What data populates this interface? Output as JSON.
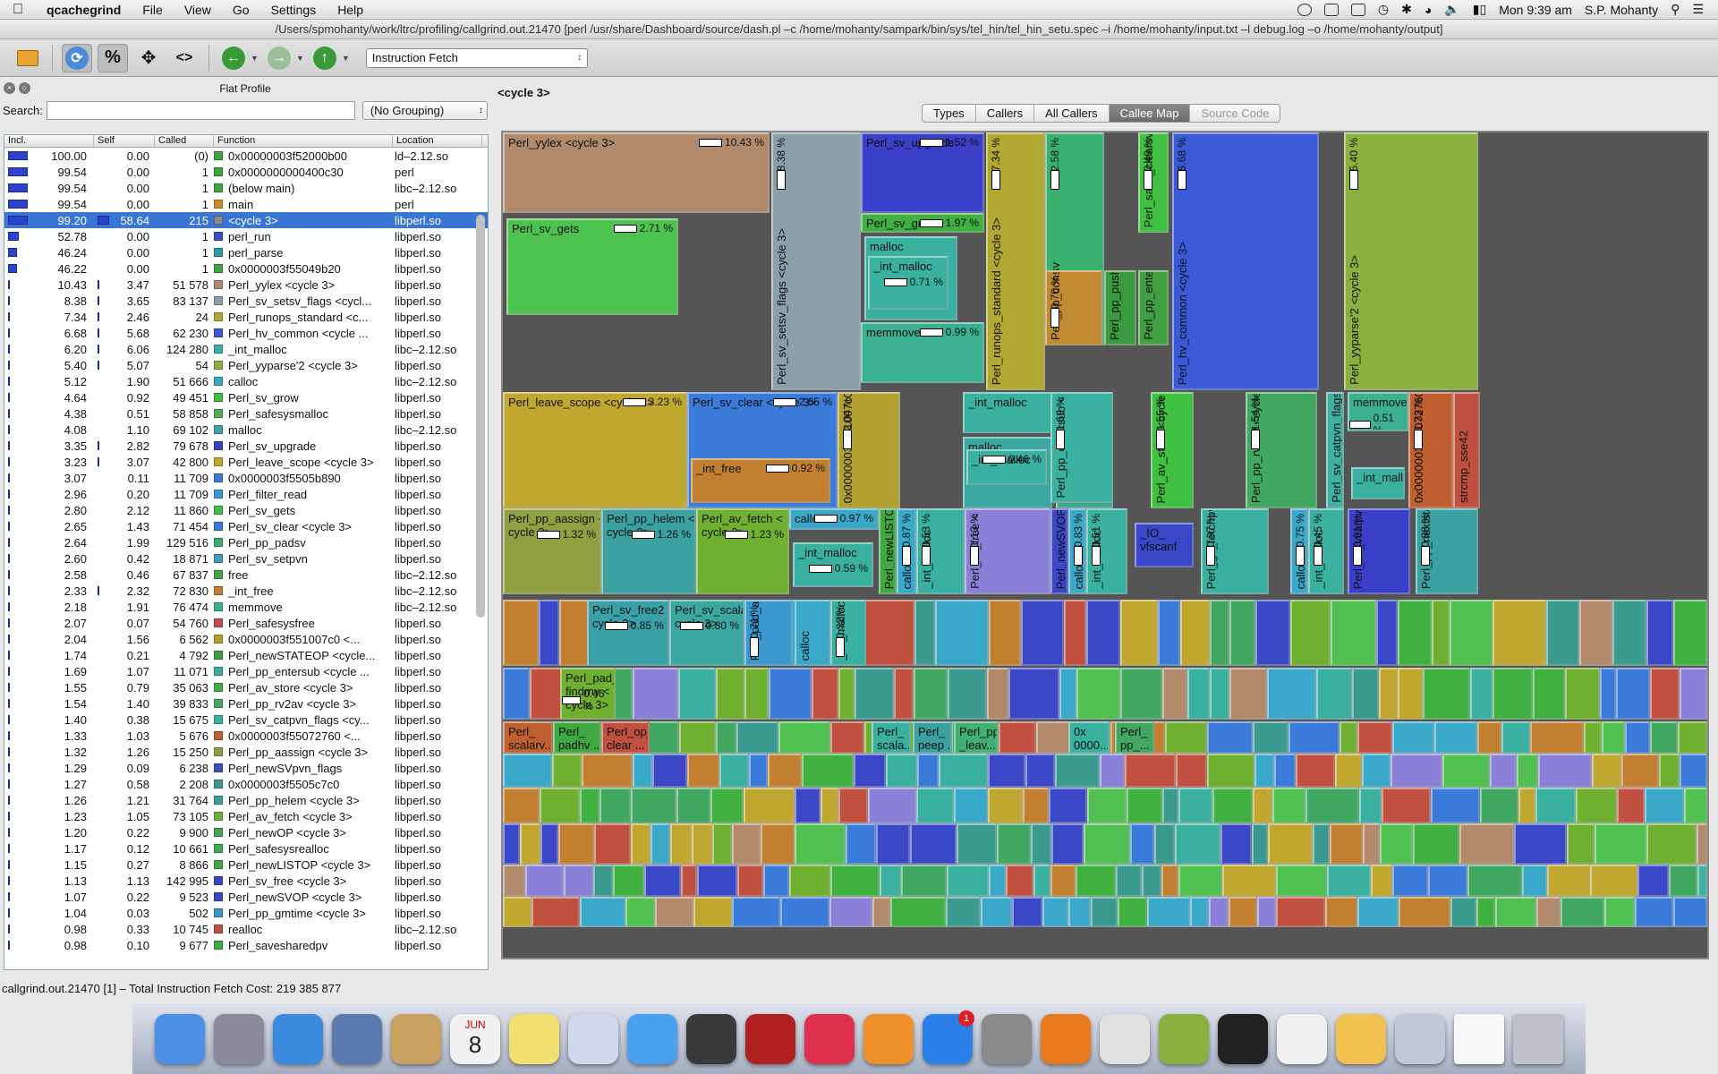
{
  "menubar": {
    "app": "qcachegrind",
    "items": [
      "File",
      "View",
      "Go",
      "Settings",
      "Help"
    ],
    "clock": "Mon 9:39 am",
    "user": "S.P. Mohanty"
  },
  "window": {
    "title": "/Users/spmohanty/work/ltrc/profiling/callgrind.out.21470 [perl /usr/share/Dashboard/source/dash.pl –c /home/mohanty/sampark/bin/sys/tel_hin/tel_hin_setu.spec –i /home/mohanty/input.txt –l debug.log –o /home/mohanty/output]"
  },
  "toolbar": {
    "percent_label": "%",
    "code_label": "<>",
    "event_type": "Instruction Fetch"
  },
  "flat_profile": {
    "title": "Flat Profile",
    "search_label": "Search:",
    "search_value": "",
    "grouping": "(No Grouping)",
    "columns": [
      "Incl.",
      "Self",
      "Called",
      "Function",
      "Location"
    ],
    "rows": [
      {
        "incl": "100.00",
        "self": "0.00",
        "called": "(0)",
        "fn": "0x00000003f52000b00",
        "loc": "ld–2.12.so",
        "color": "#3aa83a"
      },
      {
        "incl": "99.54",
        "self": "0.00",
        "called": "1",
        "fn": "0x0000000000400c30",
        "loc": "perl",
        "color": "#3aa83a"
      },
      {
        "incl": "99.54",
        "self": "0.00",
        "called": "1",
        "fn": "(below main)",
        "loc": "libc–2.12.so",
        "color": "#3aa83a"
      },
      {
        "incl": "99.54",
        "self": "0.00",
        "called": "1",
        "fn": "main",
        "loc": "perl",
        "color": "#c98a2a"
      },
      {
        "incl": "99.20",
        "self": "58.64",
        "called": "215",
        "fn": "<cycle 3>",
        "loc": "libperl.so",
        "color": "#8a8a8a",
        "selected": true
      },
      {
        "incl": "52.78",
        "self": "0.00",
        "called": "1",
        "fn": "perl_run",
        "loc": "libperl.so",
        "color": "#3a4fc8"
      },
      {
        "incl": "46.24",
        "self": "0.00",
        "called": "1",
        "fn": "perl_parse",
        "loc": "libperl.so",
        "color": "#2a9aa8"
      },
      {
        "incl": "46.22",
        "self": "0.00",
        "called": "1",
        "fn": "0x0000003f55049b20",
        "loc": "libperl.so",
        "color": "#3aa83a"
      },
      {
        "incl": "10.43",
        "self": "3.47",
        "called": "51 578",
        "fn": "Perl_yylex <cycle 3>",
        "loc": "libperl.so",
        "color": "#b08a6a"
      },
      {
        "incl": "8.38",
        "self": "3.65",
        "called": "83 137",
        "fn": "Perl_sv_setsv_flags <cycl...",
        "loc": "libperl.so",
        "color": "#8aa0a8"
      },
      {
        "incl": "7.34",
        "self": "2.46",
        "called": "24",
        "fn": "Perl_runops_standard <c...",
        "loc": "libperl.so",
        "color": "#b0a830"
      },
      {
        "incl": "6.68",
        "self": "5.68",
        "called": "62 230",
        "fn": "Perl_hv_common <cycle ...",
        "loc": "libperl.so",
        "color": "#3a5ad8"
      },
      {
        "incl": "6.20",
        "self": "6.06",
        "called": "124 280",
        "fn": "_int_malloc",
        "loc": "libc–2.12.so",
        "color": "#3ab0a8"
      },
      {
        "incl": "5.40",
        "self": "5.07",
        "called": "54",
        "fn": "Perl_yyparse'2 <cycle 3>",
        "loc": "libperl.so",
        "color": "#8ab040"
      },
      {
        "incl": "5.12",
        "self": "1.90",
        "called": "51 666",
        "fn": "calloc",
        "loc": "libc–2.12.so",
        "color": "#3aa8c8"
      },
      {
        "incl": "4.64",
        "self": "0.92",
        "called": "49 451",
        "fn": "Perl_sv_grow",
        "loc": "libperl.so",
        "color": "#40c040"
      },
      {
        "incl": "4.38",
        "self": "0.51",
        "called": "58 858",
        "fn": "Perl_safesysmalloc",
        "loc": "libperl.so",
        "color": "#50b050"
      },
      {
        "incl": "4.08",
        "self": "1.10",
        "called": "69 102",
        "fn": "malloc",
        "loc": "libc–2.12.so",
        "color": "#3aa8a0"
      },
      {
        "incl": "3.35",
        "self": "2.82",
        "called": "79 678",
        "fn": "Perl_sv_upgrade",
        "loc": "libperl.so",
        "color": "#3a40c8"
      },
      {
        "incl": "3.23",
        "self": "3.07",
        "called": "42 800",
        "fn": "Perl_leave_scope <cycle 3>",
        "loc": "libperl.so",
        "color": "#c0a830"
      },
      {
        "incl": "3.07",
        "self": "0.11",
        "called": "11 709",
        "fn": "0x0000003f5505b890",
        "loc": "libperl.so",
        "color": "#3a7ad8"
      },
      {
        "incl": "2.96",
        "self": "0.20",
        "called": "11 709",
        "fn": "Perl_filter_read",
        "loc": "libperl.so",
        "color": "#3a9ad8"
      },
      {
        "incl": "2.80",
        "self": "2.12",
        "called": "11 860",
        "fn": "Perl_sv_gets",
        "loc": "libperl.so",
        "color": "#40c040"
      },
      {
        "incl": "2.65",
        "self": "1.43",
        "called": "71 454",
        "fn": "Perl_sv_clear <cycle 3>",
        "loc": "libperl.so",
        "color": "#3a7ad8"
      },
      {
        "incl": "2.64",
        "self": "1.99",
        "called": "129 516",
        "fn": "Perl_pp_padsv",
        "loc": "libperl.so",
        "color": "#3ab070"
      },
      {
        "incl": "2.60",
        "self": "0.42",
        "called": "18 871",
        "fn": "Perl_sv_setpvn",
        "loc": "libperl.so",
        "color": "#3aa0c0"
      },
      {
        "incl": "2.58",
        "self": "0.46",
        "called": "67 837",
        "fn": "free",
        "loc": "libc–2.12.so",
        "color": "#40a840"
      },
      {
        "incl": "2.33",
        "self": "2.32",
        "called": "72 830",
        "fn": "_int_free",
        "loc": "libc–2.12.so",
        "color": "#c08030"
      },
      {
        "incl": "2.18",
        "self": "1.91",
        "called": "76 474",
        "fn": "memmove",
        "loc": "libc–2.12.so",
        "color": "#3ab090"
      },
      {
        "incl": "2.07",
        "self": "0.07",
        "called": "54 760",
        "fn": "Perl_safesysfree",
        "loc": "libperl.so",
        "color": "#c05050"
      },
      {
        "incl": "2.04",
        "self": "1.56",
        "called": "6 562",
        "fn": "0x0000003f551007c0 <...",
        "loc": "libperl.so",
        "color": "#b0a030"
      },
      {
        "incl": "1.74",
        "self": "0.21",
        "called": "4 792",
        "fn": "Perl_newSTATEOP <cycle...",
        "loc": "libperl.so",
        "color": "#3aa040"
      },
      {
        "incl": "1.69",
        "self": "1.07",
        "called": "11 071",
        "fn": "Perl_pp_entersub <cycle ...",
        "loc": "libperl.so",
        "color": "#3ab0a0"
      },
      {
        "incl": "1.55",
        "self": "0.79",
        "called": "35 063",
        "fn": "Perl_av_store <cycle 3>",
        "loc": "libperl.so",
        "color": "#40b040"
      },
      {
        "incl": "1.54",
        "self": "1.40",
        "called": "39 833",
        "fn": "Perl_pp_rv2av <cycle 3>",
        "loc": "libperl.so",
        "color": "#40a860"
      },
      {
        "incl": "1.40",
        "self": "0.38",
        "called": "15 675",
        "fn": "Perl_sv_catpvn_flags <cy...",
        "loc": "libperl.so",
        "color": "#40b0a0"
      },
      {
        "incl": "1.33",
        "self": "1.03",
        "called": "5 676",
        "fn": "0x0000003f55072760 <...",
        "loc": "libperl.so",
        "color": "#c06030"
      },
      {
        "incl": "1.32",
        "self": "1.26",
        "called": "15 250",
        "fn": "Perl_pp_aassign <cycle 3>",
        "loc": "libperl.so",
        "color": "#90a040"
      },
      {
        "incl": "1.29",
        "self": "0.09",
        "called": "6 238",
        "fn": "Perl_newSVpvn_flags",
        "loc": "libperl.so",
        "color": "#3a50c0"
      },
      {
        "incl": "1.27",
        "self": "0.58",
        "called": "2 208",
        "fn": "0x0000003f5505c7c0",
        "loc": "libperl.so",
        "color": "#3a9a90"
      },
      {
        "incl": "1.26",
        "self": "1.21",
        "called": "31 764",
        "fn": "Perl_pp_helem <cycle 3>",
        "loc": "libperl.so",
        "color": "#3aa0a0"
      },
      {
        "incl": "1.23",
        "self": "1.05",
        "called": "73 105",
        "fn": "Perl_av_fetch <cycle 3>",
        "loc": "libperl.so",
        "color": "#70b030"
      },
      {
        "incl": "1.20",
        "self": "0.22",
        "called": "9 900",
        "fn": "Perl_newOP <cycle 3>",
        "loc": "libperl.so",
        "color": "#40a850"
      },
      {
        "incl": "1.17",
        "self": "0.12",
        "called": "10 661",
        "fn": "Perl_safesysrealloc",
        "loc": "libperl.so",
        "color": "#3ab050"
      },
      {
        "incl": "1.15",
        "self": "0.27",
        "called": "8 866",
        "fn": "Perl_newLISTOP <cycle 3>",
        "loc": "libperl.so",
        "color": "#40a840"
      },
      {
        "incl": "1.13",
        "self": "1.13",
        "called": "142 995",
        "fn": "Perl_sv_free <cycle 3>",
        "loc": "libperl.so",
        "color": "#3a48c0"
      },
      {
        "incl": "1.07",
        "self": "0.22",
        "called": "9 523",
        "fn": "Perl_newSVOP <cycle 3>",
        "loc": "libperl.so",
        "color": "#3a48c8"
      },
      {
        "incl": "1.04",
        "self": "0.03",
        "called": "502",
        "fn": "Perl_pp_gmtime <cycle 3>",
        "loc": "libperl.so",
        "color": "#3a9ad0"
      },
      {
        "incl": "0.98",
        "self": "0.33",
        "called": "10 745",
        "fn": "realloc",
        "loc": "libc–2.12.so",
        "color": "#c05040"
      },
      {
        "incl": "0.98",
        "self": "0.10",
        "called": "9 677",
        "fn": "Perl_savesharedpv",
        "loc": "libperl.so",
        "color": "#3ab040"
      }
    ]
  },
  "detail": {
    "header": "<cycle 3>",
    "tabs": [
      "Types",
      "Callers",
      "All Callers",
      "Callee Map",
      "Source Code"
    ],
    "active_tab": "Callee Map"
  },
  "callee_map": [
    {
      "label": "Perl_yylex <cycle 3>",
      "pct": "10.43 %"
    },
    {
      "label": "Perl_sv_gets",
      "pct": "2.71 %"
    },
    {
      "label": "Perl_sv_upgrade",
      "pct": "1.52 %"
    },
    {
      "label": "Perl_sv_grow",
      "pct": "1.97 %"
    },
    {
      "label": "malloc",
      "pct": ""
    },
    {
      "label": "_int_malloc",
      "pct": "0.71 %"
    },
    {
      "label": "memmove",
      "pct": "0.99 %"
    },
    {
      "label": "Perl_sv_setsv_flags <cycle 3>",
      "pct": "8.38 %"
    },
    {
      "label": "Perl_runops_standard <cycle 3>",
      "pct": "7.34 %"
    },
    {
      "label": "Perl_pp_padsv",
      "pct": "2.58 %"
    },
    {
      "label": "Perl_save_clearsv",
      "pct": "0.49 %"
    },
    {
      "label": "Perl_hv_common <cycle 3>",
      "pct": "6.68 %"
    },
    {
      "label": "Perl_yyparse'2 <cycle 3>",
      "pct": "5.40 %"
    },
    {
      "label": "Perl_pp_const",
      "pct": "0.70 %"
    },
    {
      "label": "Perl_pp_pushmark",
      "pct": ""
    },
    {
      "label": "Perl_pp_enter",
      "pct": ""
    },
    {
      "label": "Perl_leave_scope <cycle 3>",
      "pct": "3.23 %"
    },
    {
      "label": "Perl_sv_clear <cycle 3>",
      "pct": "2.65 %"
    },
    {
      "label": "_int_free",
      "pct": "0.92 %"
    },
    {
      "label": "0x0000003f551007c0 <cycle 3>",
      "pct": "2.04 %"
    },
    {
      "label": "_int_malloc",
      "pct": ""
    },
    {
      "label": "malloc",
      "pct": ""
    },
    {
      "label": "_int_malloc",
      "pct": "0.46 %"
    },
    {
      "label": "memcpy",
      "pct": ""
    },
    {
      "label": "Perl_pp_entersub < cycle 3>",
      "pct": "1.69 %"
    },
    {
      "label": "Perl_av_store <cycle 3>",
      "pct": "1.55 %"
    },
    {
      "label": "Perl_pp_rv2av <cycle 3>",
      "pct": "1.54 %"
    },
    {
      "label": "Perl_sv_catpvn_flags",
      "pct": ""
    },
    {
      "label": "memmove",
      "pct": "0.51 %"
    },
    {
      "label": "_int_malloc",
      "pct": ""
    },
    {
      "label": "0x0000003f55072760 <cycle 3>",
      "pct": "1.33 %"
    },
    {
      "label": "strcmp_sse42",
      "pct": ""
    },
    {
      "label": "Perl_pp_aassign <\ncycle 3>",
      "pct": "1.32 %"
    },
    {
      "label": "Perl_pp_helem <\ncycle 3>",
      "pct": "1.26 %"
    },
    {
      "label": "Perl_av_fetch <\ncycle 3>",
      "pct": "1.23 %"
    },
    {
      "label": "calloc",
      "pct": "0.97 %"
    },
    {
      "label": "_int_malloc",
      "pct": "0.59 %"
    },
    {
      "label": "Perl_newLISTOP",
      "pct": ""
    },
    {
      "label": "calloc",
      "pct": "0.87 %"
    },
    {
      "label": "_int_malloc",
      "pct": "0.53 %"
    },
    {
      "label": "Perl_sv_free < cycle 3>",
      "pct": "1.13 %"
    },
    {
      "label": "Perl_newSVOP",
      "pct": ""
    },
    {
      "label": "calloc",
      "pct": "0.83 %"
    },
    {
      "label": "_int_malloc",
      "pct": "0.51 %"
    },
    {
      "label": "_IO_\nvfscanf",
      "pct": ""
    },
    {
      "label": "Perl_gv_fetchpvn_flags <cycle 3>",
      "pct": "0.97 %"
    },
    {
      "label": "calloc",
      "pct": "0.75 %"
    },
    {
      "label": "_int_malloc",
      "pct": "0.45 %"
    },
    {
      "label": "Perl_sv_vcatpvfn <cycle 3>",
      "pct": "0.91 %"
    },
    {
      "label": "Perl_pp_nextstate <cycle 3>",
      "pct": "0.88 %"
    },
    {
      "label": "Perl_sv_free2 <\ncycle 3>",
      "pct": "0.85 %"
    },
    {
      "label": "Perl_sv_scalar <\ncycle 3>",
      "pct": "0.80 %"
    },
    {
      "label": "Perl_pad_alloc <cycle 3>",
      "pct": "0.71 %"
    },
    {
      "label": "calloc",
      "pct": ""
    },
    {
      "label": "_int_malloc",
      "pct": "0.32 %"
    },
    {
      "label": "Perl_pad_\nfindmy <\ncycle 3>",
      "pct": "0.46 %"
    },
    {
      "label": "Perl_\nscalarv...",
      "pct": ""
    },
    {
      "label": "Perl_\npadhv ...",
      "pct": ""
    },
    {
      "label": "Perl_op_\nclear ...",
      "pct": ""
    },
    {
      "label": "Perl_\nscala...",
      "pct": ""
    },
    {
      "label": "Perl_\npeep ...",
      "pct": ""
    },
    {
      "label": "Perl_pp\n_leav...",
      "pct": ""
    },
    {
      "label": "0x\n0000...",
      "pct": ""
    },
    {
      "label": "Perl_\npp_...",
      "pct": ""
    }
  ],
  "statusbar": {
    "text": "callgrind.out.21470 [1] – Total Instruction Fetch Cost: 219 385 877"
  },
  "dock": {
    "apps": [
      "Finder",
      "Launchpad",
      "Safari",
      "Mail",
      "Contacts",
      "Calendar",
      "Notes",
      "Preview",
      "Messages",
      "FaceTime",
      "Photo Booth",
      "iTunes",
      "iBooks",
      "App Store",
      "System Preferences",
      "Sublime Text",
      "Chrome",
      "Android Studio",
      "Terminal",
      "TextEdit",
      "Photos",
      "Preview 2",
      "Documents",
      "Trash"
    ],
    "calendar_day": "8",
    "calendar_month": "JUN",
    "appstore_badge": "1"
  }
}
